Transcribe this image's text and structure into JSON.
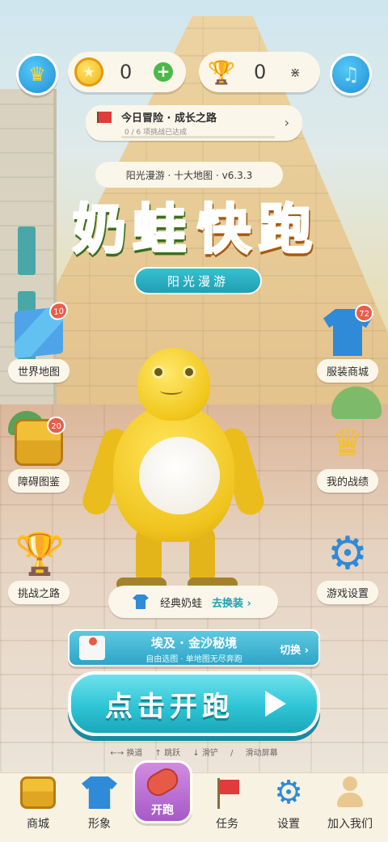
{
  "top_bar": {
    "coins": "0",
    "trophies": "0"
  },
  "quest": {
    "title": "今日冒险 · 成长之路",
    "progress_text": "0 / 6 项挑战已达成",
    "progress": 0
  },
  "version_tag": "阳光漫游 · 十大地图 · v6.3.3",
  "logo": {
    "chars": [
      "奶",
      "蛙",
      "快",
      "跑"
    ],
    "subtitle": "阳光漫游"
  },
  "left_menu": [
    {
      "label": "世界地图",
      "badge": "10",
      "icon": "map-icon"
    },
    {
      "label": "障碍图鉴",
      "badge": "20",
      "icon": "chest-icon"
    },
    {
      "label": "挑战之路",
      "badge": "",
      "icon": "trophy-icon"
    }
  ],
  "right_menu": [
    {
      "label": "服装商城",
      "badge": "72",
      "icon": "shirt-icon"
    },
    {
      "label": "我的战绩",
      "badge": "",
      "icon": "crown-icon"
    },
    {
      "label": "游戏设置",
      "badge": "",
      "icon": "gear-icon"
    }
  ],
  "outfit": {
    "name": "经典奶蛙",
    "change_label": "去换装 ›"
  },
  "map_selector": {
    "name": "埃及 · 金沙秘境",
    "subtitle": "自由选图 · 单地图无尽奔跑",
    "switch_label": "切换 ›"
  },
  "start_button": "点击开跑",
  "hints": [
    "←→ 换道",
    "↑ 跳跃",
    "↓ 滑铲",
    "/",
    "滑动屏幕"
  ],
  "bottom_nav": [
    {
      "label": "商城",
      "icon": "chest-icon"
    },
    {
      "label": "形象",
      "icon": "shirt-icon"
    },
    {
      "label": "开跑",
      "icon": "sneaker-icon"
    },
    {
      "label": "任务",
      "icon": "flag-icon"
    },
    {
      "label": "设置",
      "icon": "gear-icon"
    },
    {
      "label": "加入我们",
      "icon": "person-icon"
    }
  ],
  "colors": {
    "accent": "#2ec5d6",
    "badge": "#ea5d4a",
    "logo_green": "#8fd13d",
    "logo_orange": "#f5a21b"
  }
}
